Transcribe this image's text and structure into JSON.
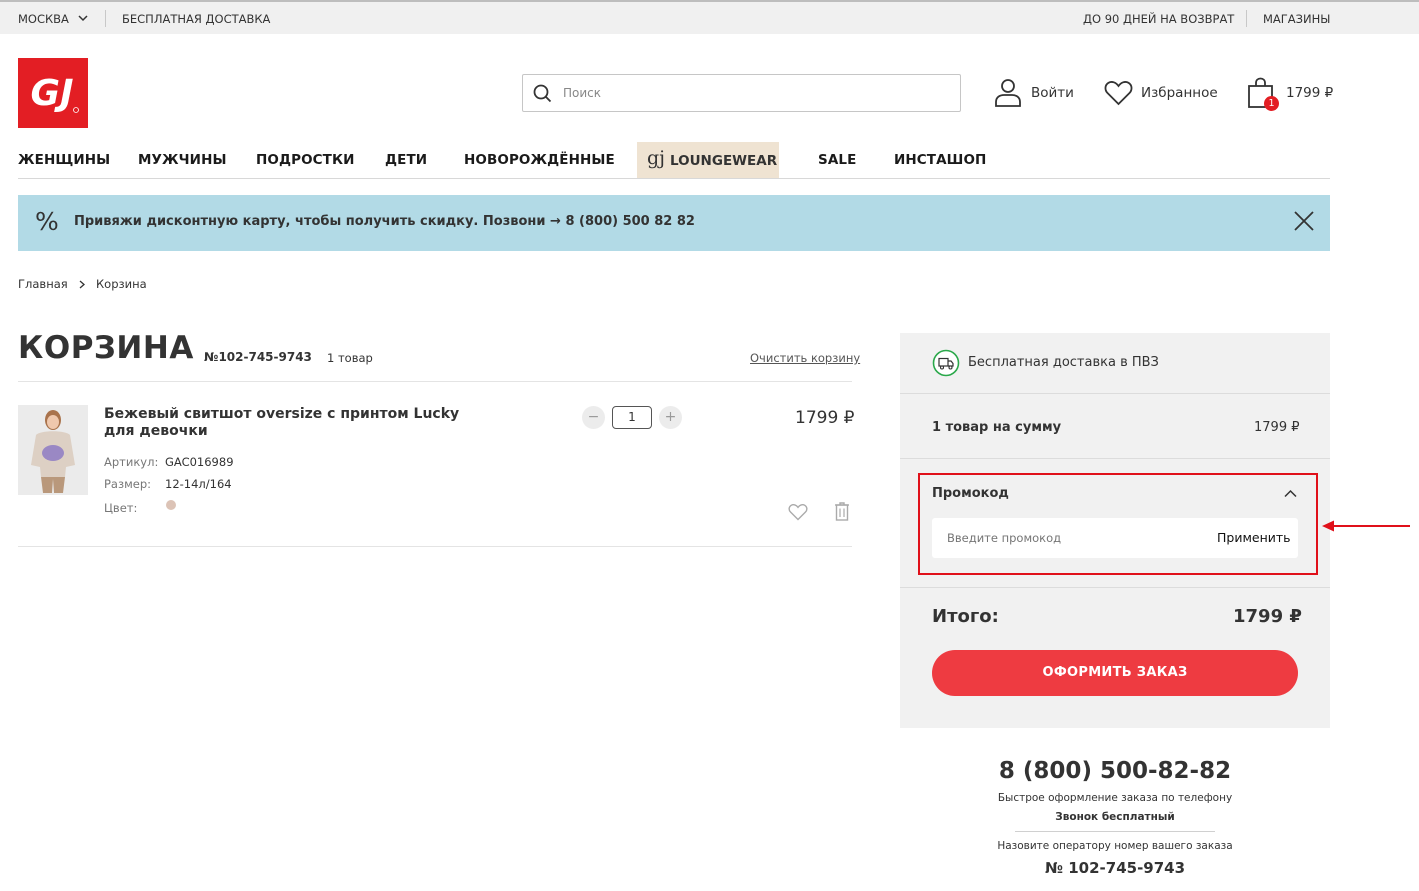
{
  "topbar": {
    "city": "МОСКВА",
    "free_delivery": "БЕСПЛАТНАЯ ДОСТАВКА",
    "returns": "ДО 90 ДНЕЙ НА ВОЗВРАТ",
    "stores": "МАГАЗИНЫ"
  },
  "header": {
    "logo_text": "GJ",
    "search_placeholder": "Поиск",
    "login": "Войти",
    "favorites": "Избранное",
    "cart_total": "1799 ₽",
    "cart_count": "1"
  },
  "nav": {
    "items": [
      "ЖЕНЩИНЫ",
      "МУЖЧИНЫ",
      "ПОДРОСТКИ",
      "ДЕТИ",
      "НОВОРОЖДЁННЫЕ"
    ],
    "lounge_logo": "gj",
    "lounge_label": "LOUNGEWEAR",
    "sale": "SALE",
    "instashop": "ИНСТАШОП"
  },
  "banner": {
    "percent_icon": "%",
    "text": "Привяжи дисконтную карту, чтобы получить скидку. Позвони →",
    "phone": "8 (800) 500 82 82"
  },
  "breadcrumbs": [
    "Главная",
    "Корзина"
  ],
  "cart": {
    "title": "КОРЗИНА",
    "order_number": "№102-745-9743",
    "item_count": "1 товар",
    "clear": "Очистить корзину",
    "product": {
      "name": "Бежевый свитшот oversize с принтом Lucky для девочки",
      "article_label": "Артикул:",
      "article": "GAC016989",
      "size_label": "Размер:",
      "size": "12-14л/164",
      "color_label": "Цвет:",
      "color_hex": "#dcc3b6",
      "quantity": "1",
      "minus": "−",
      "plus": "+",
      "price": "1799 ₽"
    }
  },
  "summary": {
    "delivery": "Бесплатная доставка в ПВЗ",
    "items_sum_label": "1 товар на сумму",
    "items_sum": "1799 ₽",
    "promo_title": "Промокод",
    "promo_placeholder": "Введите промокод",
    "promo_apply": "Применить",
    "total_label": "Итого:",
    "total": "1799 ₽",
    "order_button": "ОФОРМИТЬ ЗАКАЗ"
  },
  "phone_block": {
    "phone": "8 (800) 500-82-82",
    "line1": "Быстрое оформление заказа по телефону",
    "line2": "Звонок бесплатный",
    "line3": "Назовите оператору номер вашего заказа",
    "order": "№ 102-745-9743"
  },
  "colors": {
    "brand_red": "#e31e24",
    "button_red": "#ee3b41",
    "banner_blue": "#b2dae6",
    "highlight": "#e0101a"
  }
}
